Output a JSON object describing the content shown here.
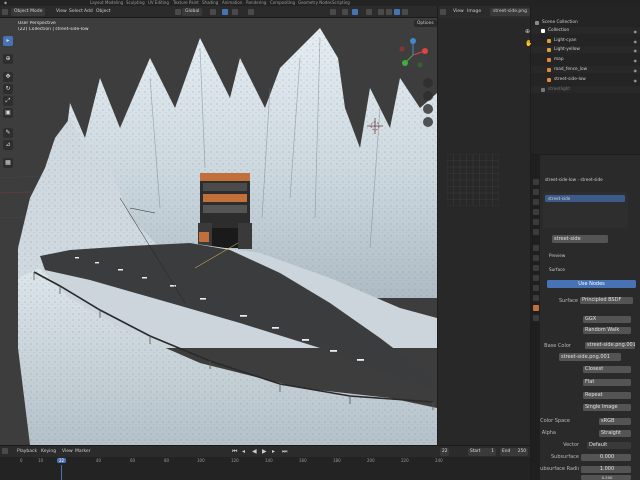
{
  "topbar": {
    "tabs": [
      "Layout",
      "Modeling",
      "Sculpting",
      "UV Editing",
      "Texture Paint",
      "Shading",
      "Animation",
      "Rendering",
      "Compositing",
      "Geometry Nodes",
      "Scripting"
    ],
    "active_tab": "Layout"
  },
  "viewport_header": {
    "mode": "Object Mode",
    "menus": [
      "View",
      "Select",
      "Add",
      "Object"
    ],
    "orientation": "Global",
    "options_label": "Options"
  },
  "viewport_overlay": {
    "perspective": "User Perspective",
    "collection": "(22) Collection | street-side-low"
  },
  "image_editor": {
    "menus": [
      "View",
      "Image"
    ],
    "image_name": "street-side.png"
  },
  "outliner": {
    "scene_collection": "Scene Collection",
    "items": [
      {
        "label": "Collection",
        "indent": 1,
        "icon_color": "#ffffff"
      },
      {
        "label": "Light-cyan",
        "indent": 2,
        "icon_color": "#e0a030"
      },
      {
        "label": "Light-yellow",
        "indent": 2,
        "icon_color": "#e0a030"
      },
      {
        "label": "map",
        "indent": 2,
        "icon_color": "#e08a3c"
      },
      {
        "label": "road_fence_low",
        "indent": 2,
        "icon_color": "#e08a3c"
      },
      {
        "label": "street-side-low",
        "indent": 2,
        "icon_color": "#e08a3c"
      },
      {
        "label": "streetlight",
        "indent": 1,
        "icon_color": "#777777"
      }
    ]
  },
  "properties": {
    "breadcrumb_object": "street-side-low",
    "breadcrumb_material": "street-side",
    "material_slot": "street-side",
    "material_name": "street-side",
    "preview_label": "Preview",
    "surface_panel": "Surface",
    "use_nodes_label": "Use Nodes",
    "surface_label": "Surface",
    "surface_value": "Principled BSDF",
    "distribution": "GGX",
    "subsurface_method": "Random Walk",
    "base_color_label": "Base Color",
    "base_color_value": "street-side.png.001",
    "image_datablock": "street-side.png.001",
    "interpolation": "Closest",
    "projection": "Flat",
    "extension": "Repeat",
    "source": "Single Image",
    "color_space_label": "Color Space",
    "color_space_value": "sRGB",
    "alpha_label": "Alpha",
    "alpha_value": "Straight",
    "vector_label": "Vector",
    "vector_value": "Default",
    "subsurface_label": "Subsurface",
    "subsurface_value": "0.000",
    "subsurface_radius_label": "Subsurface Radius",
    "subsurface_radius_value": "1.000",
    "extra_value": "0.200"
  },
  "timeline": {
    "menus": [
      "Playback",
      "Keying",
      "View",
      "Marker"
    ],
    "current_frame": "22",
    "start_label": "Start",
    "start_value": "1",
    "end_label": "End",
    "end_value": "250",
    "ruler": [
      "0",
      "10",
      "22",
      "40",
      "60",
      "80",
      "100",
      "120",
      "140",
      "160",
      "180",
      "200",
      "220",
      "240"
    ]
  },
  "colors": {
    "accent": "#4772b3",
    "material_orange": "#c2703b",
    "snow": "#dfe8ee",
    "asphalt": "#3a3a3a"
  }
}
